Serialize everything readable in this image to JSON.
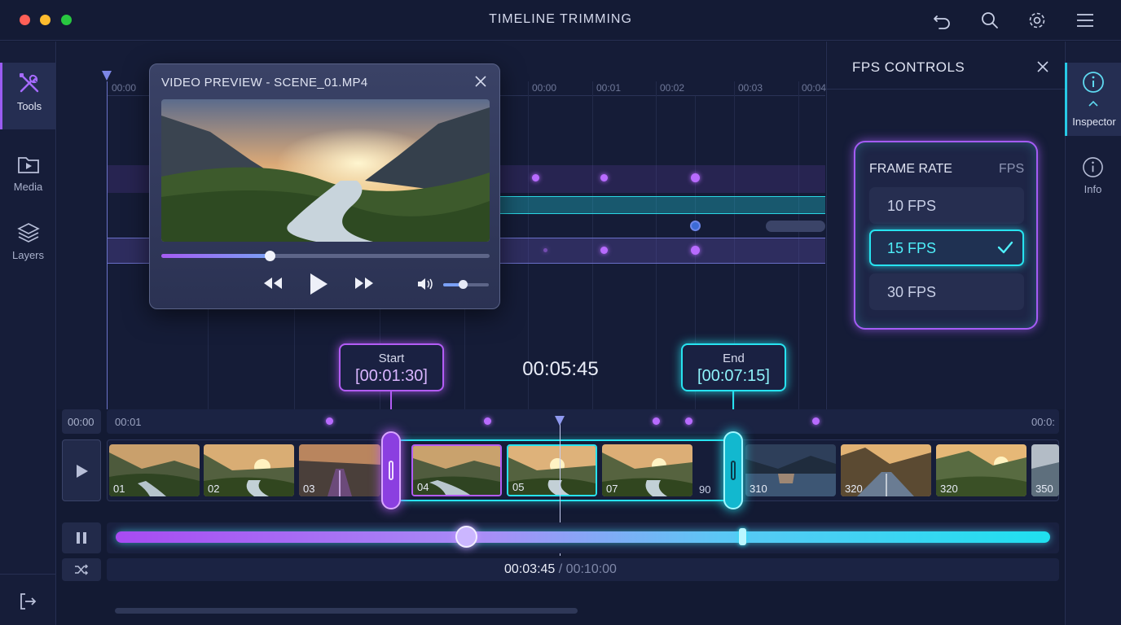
{
  "window": {
    "title": "TIMELINE TRIMMING",
    "traffic_colors": [
      "#ff5f57",
      "#febc2e",
      "#28c840"
    ],
    "toolbar_icons": [
      "undo-icon",
      "search-icon",
      "settings-icon",
      "menu-icon"
    ]
  },
  "sidebar": {
    "items": [
      {
        "label": "Tools",
        "icon": "tools-icon",
        "active": true
      },
      {
        "label": "Media",
        "icon": "media-icon",
        "active": false
      },
      {
        "label": "Layers",
        "icon": "layers-icon",
        "active": false
      }
    ],
    "exit_icon": "exit-icon"
  },
  "upper_ruler": {
    "labels": [
      "00:00",
      "00:00",
      "00:01",
      "00:02",
      "00:03",
      "00:04"
    ]
  },
  "preview": {
    "title": "VIDEO PREVIEW - SCENE_01.MP4",
    "progress": 0.33,
    "volume": 0.42,
    "icons": [
      "close-icon",
      "rewind-icon",
      "play-icon",
      "fast-forward-icon",
      "volume-icon"
    ]
  },
  "fps_panel": {
    "title": "FPS CONTROLS",
    "card_title": "FRAME RATE",
    "card_unit": "FPS",
    "options": [
      "10 FPS",
      "15 FPS",
      "30 FPS"
    ],
    "selected": "15 FPS"
  },
  "right_strip": {
    "items": [
      {
        "label": "Inspector",
        "icon": "info-icon",
        "active": true
      },
      {
        "label": "Info",
        "icon": "info-icon",
        "active": false
      }
    ]
  },
  "trim": {
    "start_label": "Start",
    "start_value": "[00:01:30]",
    "end_label": "End",
    "end_value": "[00:07:15]",
    "duration": "00:05:45"
  },
  "timeline": {
    "ruler_start": "00:00",
    "ruler_first_tick": "00:01",
    "ruler_end": "00:0:",
    "clips": [
      "01",
      "02",
      "03",
      "04",
      "05",
      "07",
      "90",
      "310",
      "320",
      "320",
      "350"
    ]
  },
  "playback": {
    "current": "00:03:45",
    "separator": "/",
    "total": "00:10:00",
    "position": 0.375
  },
  "colors": {
    "accent_purple": "#a45cf5",
    "accent_cyan": "#27e3f0",
    "background": "#131a33"
  }
}
